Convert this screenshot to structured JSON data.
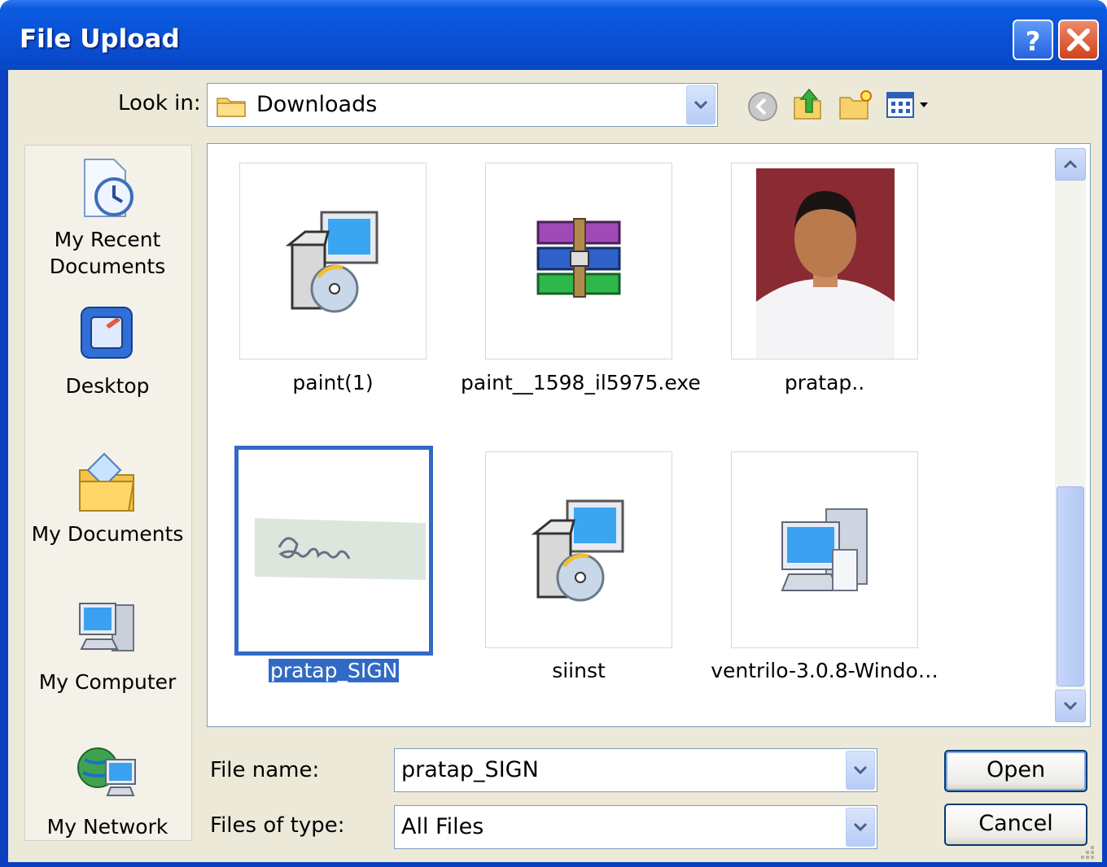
{
  "window": {
    "title": "File Upload"
  },
  "toolbar": {
    "look_in_label": "Look in:",
    "look_in_value": "Downloads",
    "icons": [
      "back-icon",
      "up-folder-icon",
      "new-folder-icon",
      "views-menu-icon"
    ]
  },
  "places": [
    {
      "label_line1": "My Recent",
      "label_line2": "Documents",
      "icon": "recent-documents-icon"
    },
    {
      "label_line1": "Desktop",
      "label_line2": "",
      "icon": "desktop-icon"
    },
    {
      "label_line1": "My Documents",
      "label_line2": "",
      "icon": "my-documents-icon"
    },
    {
      "label_line1": "My Computer",
      "label_line2": "",
      "icon": "my-computer-icon"
    },
    {
      "label_line1": "My Network",
      "label_line2": "",
      "icon": "my-network-icon"
    }
  ],
  "files": [
    {
      "name": "paint(1)",
      "icon": "installer-icon",
      "selected": false
    },
    {
      "name": "paint__1598_il5975.exe",
      "icon": "archive-icon",
      "selected": false
    },
    {
      "name": "pratap..",
      "icon": "photo-thumbnail",
      "selected": false
    },
    {
      "name": "pratap_SIGN",
      "icon": "signature-thumbnail",
      "selected": true
    },
    {
      "name": "siinst",
      "icon": "installer-icon",
      "selected": false
    },
    {
      "name": "ventrilo-3.0.8-Windo…",
      "icon": "computer-setup-icon",
      "selected": false
    }
  ],
  "form": {
    "file_name_label": "File name:",
    "file_name_value": "pratap_SIGN",
    "file_type_label": "Files of type:",
    "file_type_value": "All Files",
    "open_label": "Open",
    "cancel_label": "Cancel"
  },
  "colors": {
    "titlebar": "#0a4fd4",
    "selection": "#316ac5",
    "dialog_bg": "#ece9d8"
  }
}
